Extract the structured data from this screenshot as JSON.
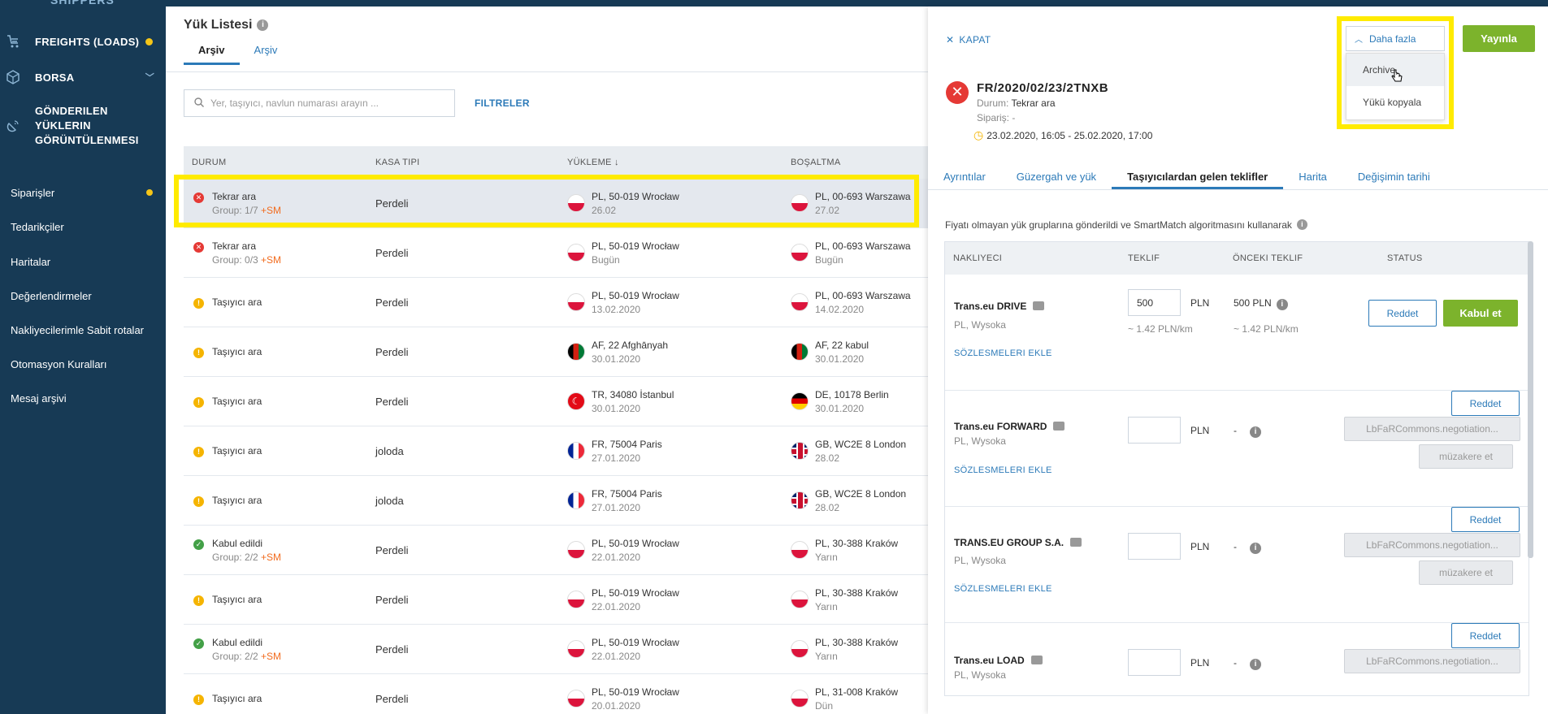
{
  "brand": "SHIPPERS",
  "sidebar": {
    "items": [
      {
        "label": "FREIGHTS (LOADS)",
        "icon": "freight-icon"
      },
      {
        "label": "BORSA",
        "icon": "exchange-icon"
      },
      {
        "label": "GÖNDERILEN YÜKLERIN GÖRÜNTÜLENMESI",
        "l1": "GÖNDERILEN",
        "l2": "YÜKLERIN",
        "l3": "GÖRÜNTÜLENMESI",
        "icon": "satellite-icon"
      },
      {
        "label": "Siparişler"
      },
      {
        "label": "Tedarikçiler"
      },
      {
        "label": "Haritalar"
      },
      {
        "label": "Değerlendirmeler"
      },
      {
        "label": "Nakliyecilerimle Sabit rotalar"
      },
      {
        "label": "Otomasyon Kuralları"
      },
      {
        "label": "Mesaj arşivi"
      }
    ]
  },
  "list": {
    "title": "Yük Listesi",
    "tabs": [
      "Arşiv",
      "Arşiv"
    ],
    "search_placeholder": "Yer, taşıyıcı, navlun numarası arayın ...",
    "filters_label": "FILTRELER",
    "columns": [
      "DURUM",
      "KASA TIPI",
      "YÜKLEME ↓",
      "BOŞALTMA"
    ],
    "rows": [
      {
        "status": "Tekrar ara",
        "status_color": "red",
        "group": "Group: 1/7",
        "sm": "+SM",
        "kasa": "Perdeli",
        "load_flag": "pl",
        "load_loc": "PL, 50-019 Wrocław",
        "load_date": "26.02",
        "unload_flag": "pl",
        "unload_loc": "PL, 00-693 Warszawa",
        "unload_date": "27.02"
      },
      {
        "status": "Tekrar ara",
        "status_color": "red",
        "group": "Group: 0/3",
        "sm": "+SM",
        "kasa": "Perdeli",
        "load_flag": "pl",
        "load_loc": "PL, 50-019 Wrocław",
        "load_date": "Bugün",
        "unload_flag": "pl",
        "unload_loc": "PL, 00-693 Warszawa",
        "unload_date": "Bugün"
      },
      {
        "status": "Taşıyıcı ara",
        "status_color": "yellow",
        "group": "",
        "sm": "",
        "kasa": "Perdeli",
        "load_flag": "pl",
        "load_loc": "PL, 50-019 Wrocław",
        "load_date": "13.02.2020",
        "unload_flag": "pl",
        "unload_loc": "PL, 00-693 Warszawa",
        "unload_date": "14.02.2020"
      },
      {
        "status": "Taşıyıcı ara",
        "status_color": "yellow",
        "group": "",
        "sm": "",
        "kasa": "Perdeli",
        "load_flag": "af",
        "load_loc": "AF, 22 Afghānyah",
        "load_date": "30.01.2020",
        "unload_flag": "af",
        "unload_loc": "AF, 22 kabul",
        "unload_date": "30.01.2020"
      },
      {
        "status": "Taşıyıcı ara",
        "status_color": "yellow",
        "group": "",
        "sm": "",
        "kasa": "Perdeli",
        "load_flag": "tr",
        "load_loc": "TR, 34080 İstanbul",
        "load_date": "30.01.2020",
        "unload_flag": "de",
        "unload_loc": "DE, 10178 Berlin",
        "unload_date": "30.01.2020"
      },
      {
        "status": "Taşıyıcı ara",
        "status_color": "yellow",
        "group": "",
        "sm": "",
        "kasa": "joloda",
        "load_flag": "fr",
        "load_loc": "FR, 75004 Paris",
        "load_date": "27.01.2020",
        "unload_flag": "gb",
        "unload_loc": "GB, WC2E 8 London",
        "unload_date": "28.02"
      },
      {
        "status": "Taşıyıcı ara",
        "status_color": "yellow",
        "group": "",
        "sm": "",
        "kasa": "joloda",
        "load_flag": "fr",
        "load_loc": "FR, 75004 Paris",
        "load_date": "27.01.2020",
        "unload_flag": "gb",
        "unload_loc": "GB, WC2E 8 London",
        "unload_date": "28.02"
      },
      {
        "status": "Kabul edildi",
        "status_color": "green",
        "group": "Group: 2/2",
        "sm": "+SM",
        "kasa": "Perdeli",
        "load_flag": "pl",
        "load_loc": "PL, 50-019 Wrocław",
        "load_date": "22.01.2020",
        "unload_flag": "pl",
        "unload_loc": "PL, 30-388 Kraków",
        "unload_date": "Yarın"
      },
      {
        "status": "Taşıyıcı ara",
        "status_color": "yellow",
        "group": "",
        "sm": "",
        "kasa": "Perdeli",
        "load_flag": "pl",
        "load_loc": "PL, 50-019 Wrocław",
        "load_date": "22.01.2020",
        "unload_flag": "pl",
        "unload_loc": "PL, 30-388 Kraków",
        "unload_date": "Yarın"
      },
      {
        "status": "Kabul edildi",
        "status_color": "green",
        "group": "Group: 2/2",
        "sm": "+SM",
        "kasa": "Perdeli",
        "load_flag": "pl",
        "load_loc": "PL, 50-019 Wrocław",
        "load_date": "22.01.2020",
        "unload_flag": "pl",
        "unload_loc": "PL, 30-388 Kraków",
        "unload_date": "Yarın"
      },
      {
        "status": "Taşıyıcı ara",
        "status_color": "yellow",
        "group": "",
        "sm": "",
        "kasa": "Perdeli",
        "load_flag": "pl",
        "load_loc": "PL, 50-019 Wrocław",
        "load_date": "20.01.2020",
        "unload_flag": "pl",
        "unload_loc": "PL, 31-008 Kraków",
        "unload_date": "Dün"
      }
    ]
  },
  "detail": {
    "close_label": "KAPAT",
    "more_label": "Daha fazla",
    "publish_label": "Yayınla",
    "menu": [
      "Archive",
      "Yükü kopyala"
    ],
    "ref": "FR/2020/02/23/2TNXB",
    "durum_label": "Durum:",
    "durum_value": "Tekrar ara",
    "siparis_label": "Sipariş:",
    "siparis_value": "-",
    "dates": "23.02.2020, 16:05 - 25.02.2020, 17:00",
    "tabs": [
      "Ayrıntılar",
      "Güzergah ve yük",
      "Taşıyıcılardan gelen teklifler",
      "Harita",
      "Değişimin tarihi"
    ],
    "note": "Fiyatı olmayan yük gruplarına gönderildi ve SmartMatch algoritmasını kullanarak",
    "offer_columns": [
      "NAKLIYECI",
      "TEKLIF",
      "ÖNCEKI TEKLIF",
      "STATUS"
    ],
    "offers": [
      {
        "name": "Trans.eu DRIVE",
        "loc": "PL, Wysoka",
        "value": "500",
        "currency": "PLN",
        "per_km": "~ 1.42 PLN/km",
        "prev": "500 PLN",
        "prev_per_km": "~ 1.42 PLN/km",
        "link": "SÖZLESMELERI EKLE",
        "reject": "Reddet",
        "accept": "Kabul et"
      },
      {
        "name": "Trans.eu FORWARD",
        "loc": "PL, Wysoka",
        "value": "",
        "currency": "PLN",
        "prev": "-",
        "link": "SÖZLESMELERI EKLE",
        "reject": "Reddet",
        "gray1": "LbFaRCommons.negotiation...",
        "gray2": "müzakere et"
      },
      {
        "name": "TRANS.EU GROUP S.A.",
        "loc": "PL, Wysoka",
        "value": "",
        "currency": "PLN",
        "prev": "-",
        "link": "SÖZLESMELERI EKLE",
        "reject": "Reddet",
        "gray1": "LbFaRCommons.negotiation...",
        "gray2": "müzakere et"
      },
      {
        "name": "Trans.eu LOAD",
        "loc": "PL, Wysoka",
        "value": "",
        "currency": "PLN",
        "prev": "-",
        "link": "",
        "reject": "Reddet",
        "gray1": "LbFaRCommons.negotiation...",
        "gray2": ""
      }
    ]
  },
  "colors": {
    "sidebar": "#173a55",
    "accent": "#2c7ab8",
    "green": "#7cb32c",
    "highlight": "#ffeb00",
    "sm": "#f26b1d"
  }
}
